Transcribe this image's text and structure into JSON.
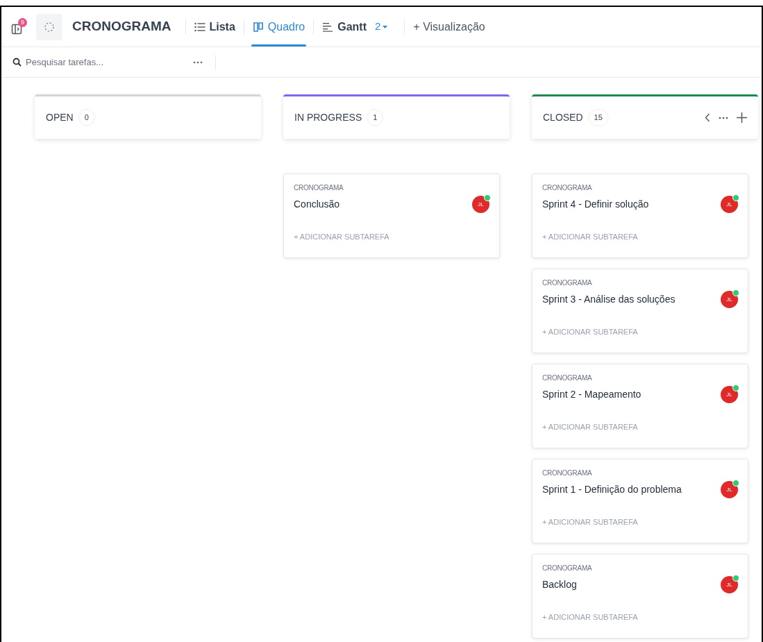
{
  "header": {
    "notification_count": "9",
    "title": "CRONOGRAMA",
    "views": [
      {
        "kind": "list",
        "label": "Lista",
        "selected": false
      },
      {
        "kind": "board",
        "label": "Quadro",
        "selected": true
      },
      {
        "kind": "gantt",
        "label": "Gantt",
        "count": "2",
        "selected": false
      }
    ],
    "add_view": "+ Visualização"
  },
  "search": {
    "placeholder": "Pesquisar tarefas..."
  },
  "columns": [
    {
      "name": "OPEN",
      "count": "0",
      "color": "#d1d5db",
      "actions": false
    },
    {
      "name": "IN PROGRESS",
      "count": "1",
      "color": "#7b68ee",
      "actions": false,
      "cards": [
        {
          "list": "CRONOGRAMA",
          "title": "Conclusão",
          "assignee": "JL",
          "add_subtask": "+ ADICIONAR SUBTAREFA"
        }
      ]
    },
    {
      "name": "CLOSED",
      "count": "15",
      "color": "#1f8a4c",
      "actions": true,
      "cards": [
        {
          "list": "CRONOGRAMA",
          "title": "Sprint 4 - Definir solução",
          "assignee": "JL",
          "add_subtask": "+ ADICIONAR SUBTAREFA"
        },
        {
          "list": "CRONOGRAMA",
          "title": "Sprint 3 - Análise das soluções",
          "assignee": "JL",
          "add_subtask": "+ ADICIONAR SUBTAREFA"
        },
        {
          "list": "CRONOGRAMA",
          "title": "Sprint 2 - Mapeamento",
          "assignee": "JL",
          "add_subtask": "+ ADICIONAR SUBTAREFA"
        },
        {
          "list": "CRONOGRAMA",
          "title": "Sprint 1 - Definição do problema",
          "assignee": "JL",
          "add_subtask": "+ ADICIONAR SUBTAREFA"
        },
        {
          "list": "CRONOGRAMA",
          "title": "Backlog",
          "assignee": "JL",
          "add_subtask": "+ ADICIONAR SUBTAREFA"
        }
      ]
    }
  ]
}
